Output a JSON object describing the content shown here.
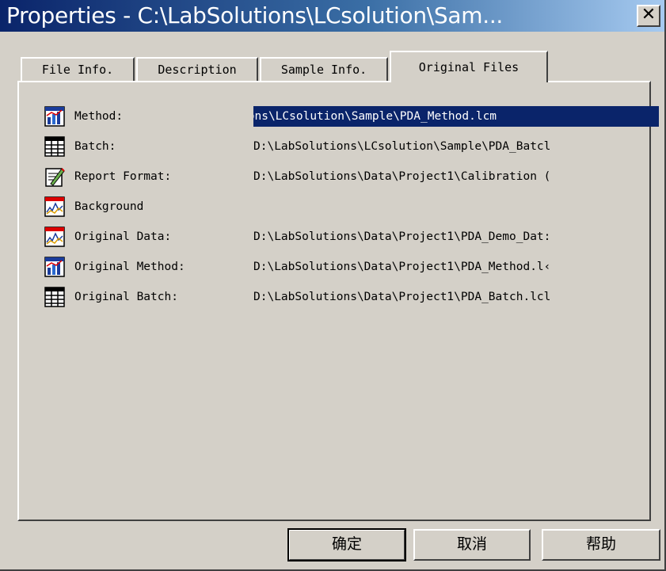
{
  "window": {
    "title": "Properties - C:\\LabSolutions\\LCsolution\\Sam...",
    "close_label": "✕"
  },
  "tabs": [
    {
      "label": "File Info.",
      "active": false
    },
    {
      "label": "Description",
      "active": false
    },
    {
      "label": "Sample Info.",
      "active": false
    },
    {
      "label": "Original Files",
      "active": true
    }
  ],
  "files": [
    {
      "label": "Method:",
      "value": "D:\\LabSolutions\\LCsolution\\Sample\\PDA_Method.lcm",
      "icon": "method-icon",
      "selected": true
    },
    {
      "label": "Batch:",
      "value": "D:\\LabSolutions\\LCsolution\\Sample\\PDA_Batcl",
      "icon": "batch-icon",
      "selected": false
    },
    {
      "label": "Report Format:",
      "value": "D:\\LabSolutions\\Data\\Project1\\Calibration (",
      "icon": "report-format-icon",
      "selected": false
    },
    {
      "label": "Background",
      "value": "",
      "icon": "data-icon",
      "selected": false
    },
    {
      "label": "Original Data:",
      "value": "D:\\LabSolutions\\Data\\Project1\\PDA_Demo_Dat:",
      "icon": "data-icon",
      "selected": false
    },
    {
      "label": "Original Method:",
      "value": "D:\\LabSolutions\\Data\\Project1\\PDA_Method.l‹",
      "icon": "method-icon",
      "selected": false
    },
    {
      "label": "Original Batch:",
      "value": "D:\\LabSolutions\\Data\\Project1\\PDA_Batch.lcl",
      "icon": "batch-icon",
      "selected": false
    }
  ],
  "buttons": {
    "ok": "确定",
    "cancel": "取消",
    "help": "帮助"
  },
  "colors": {
    "face": "#d4d0c8",
    "title_start": "#0a246a",
    "title_end": "#a6caf0",
    "selection": "#0a246a"
  }
}
